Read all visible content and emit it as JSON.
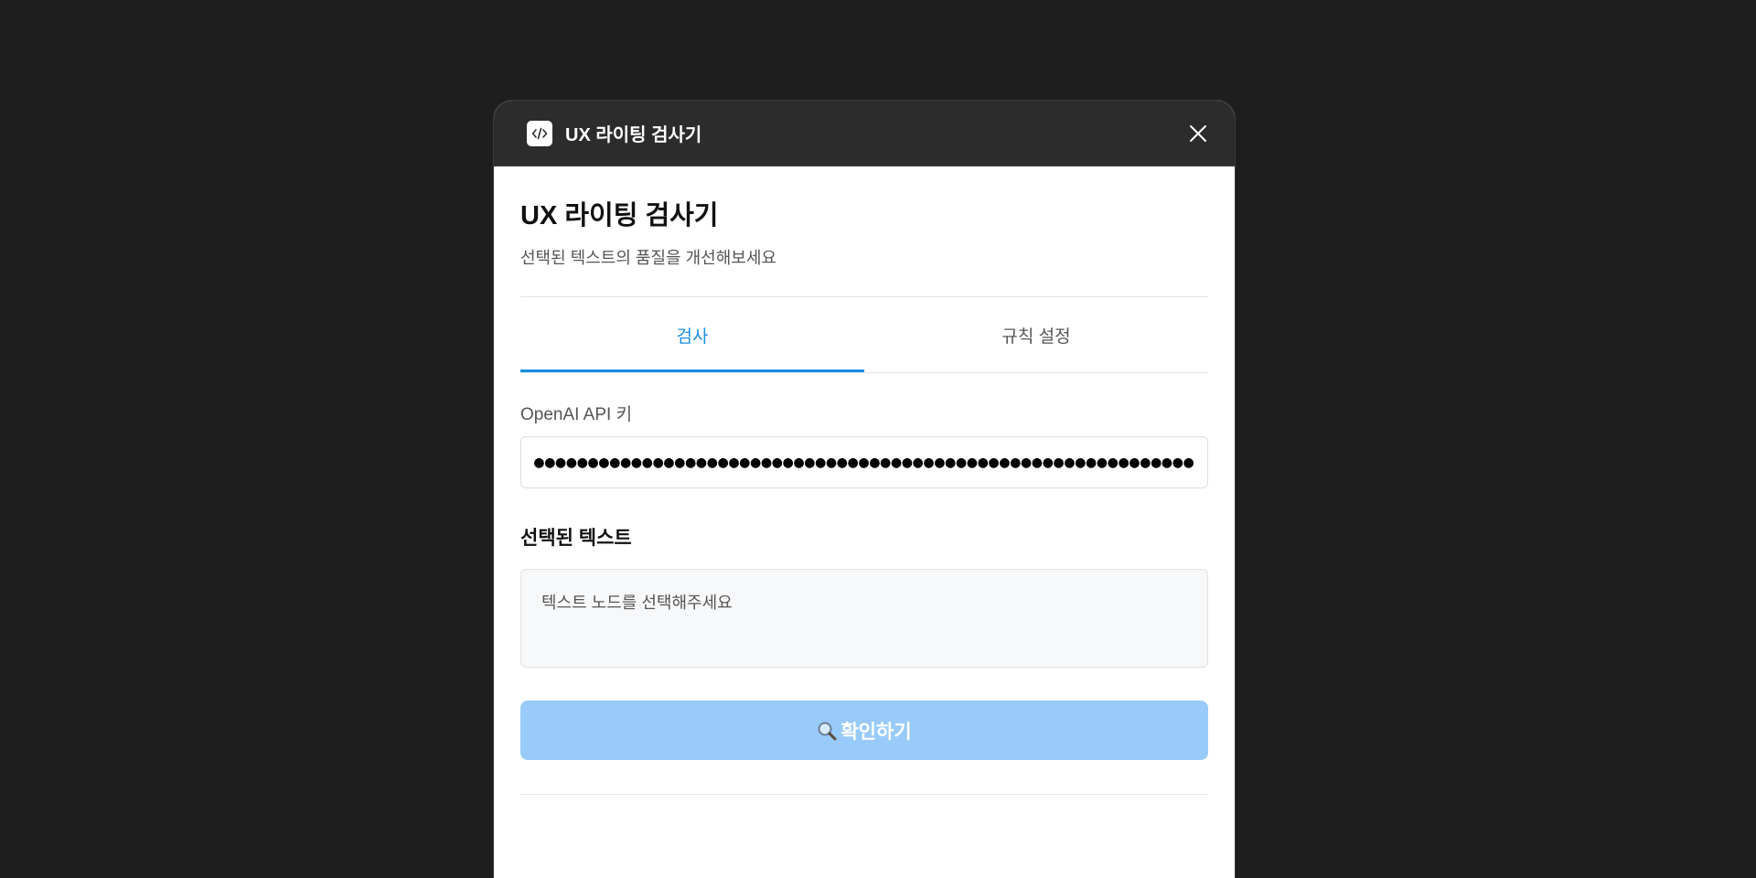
{
  "window": {
    "title": "UX 라이팅 검사기",
    "app_icon": "code-icon",
    "close_icon": "close-icon"
  },
  "header": {
    "title": "UX 라이팅 검사기",
    "subtitle": "선택된 텍스트의 품질을 개선해보세요"
  },
  "tabs": [
    {
      "label": "검사",
      "active": true
    },
    {
      "label": "규칙 설정",
      "active": false
    }
  ],
  "api_key": {
    "label": "OpenAI API 키",
    "value": "●●●●●●●●●●●●●●●●●●●●●●●●●●●●●●●●●●●●●●●●●●●●●●●●●●●●●●●●●●●●●●●●●●●●●●●●"
  },
  "selected_text": {
    "title": "선택된 텍스트",
    "placeholder": "텍스트 노드를 선택해주세요"
  },
  "confirm_button": {
    "label": "확인하기",
    "icon": "magnifier-icon"
  },
  "colors": {
    "accent": "#1a8fe3",
    "button_disabled": "#99cbfa",
    "titlebar": "#2c2c2c",
    "background": "#1e1e1e"
  }
}
